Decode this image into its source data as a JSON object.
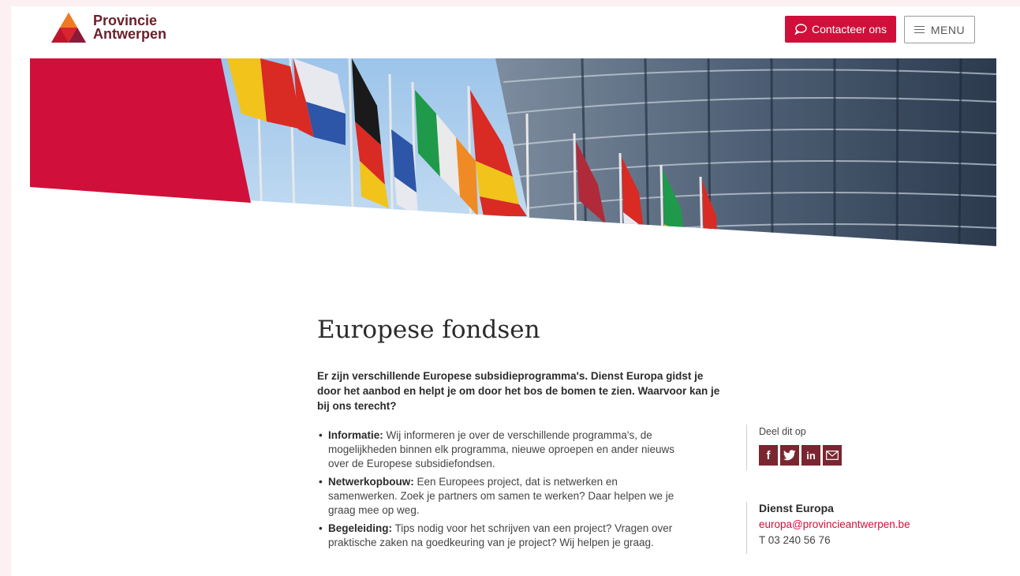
{
  "header": {
    "logo_line1": "Provincie",
    "logo_line2": "Antwerpen",
    "contact_button": "Contacteer ons",
    "menu_button": "MENU"
  },
  "colors": {
    "accent": "#d0103a",
    "brand_dark": "#6a1f2a",
    "share_icon_bg": "#7a2630"
  },
  "main": {
    "title": "Europese fondsen",
    "intro": "Er zijn verschillende Europese subsidieprogramma's. Dienst Europa gidst je door het aanbod en helpt je om door het bos de bomen te zien. Waarvoor kan je bij ons terecht?",
    "items": [
      {
        "term": "Informatie:",
        "text": " Wij informeren je over de verschillende programma's, de mogelijkheden binnen elk programma, nieuwe oproepen en ander nieuws over de Europese subsidiefondsen."
      },
      {
        "term": "Netwerkopbouw:",
        "text": " Een Europees project, dat is netwerken en samenwerken. Zoek je partners om samen te werken? Daar helpen we je graag mee op weg."
      },
      {
        "term": "Begeleiding:",
        "text": " Tips nodig voor het schrijven van een project? Vragen over praktische zaken na goedkeuring van je project? Wij helpen je graag."
      }
    ]
  },
  "sidebar": {
    "share_label": "Deel dit op",
    "share_icons": [
      "facebook-icon",
      "twitter-icon",
      "linkedin-icon",
      "mail-icon"
    ],
    "contact_title": "Dienst Europa",
    "contact_email": "europa@provincieantwerpen.be",
    "contact_phone": "T 03 240 56 76"
  }
}
